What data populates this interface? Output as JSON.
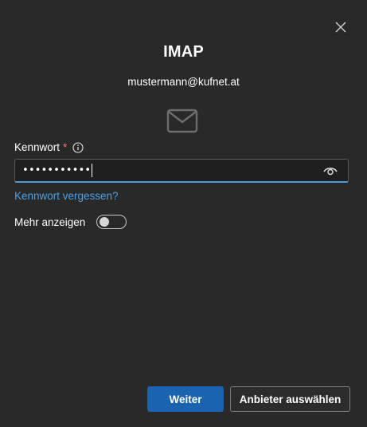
{
  "dialog": {
    "title": "IMAP",
    "email": "mustermann@kufnet.at",
    "password": {
      "label": "Kennwort",
      "required_marker": "*",
      "masked_value": "•••••••••••",
      "forgot_link": "Kennwort vergessen?"
    },
    "more": {
      "label": "Mehr anzeigen",
      "toggle_on": false
    },
    "buttons": {
      "primary": "Weiter",
      "secondary": "Anbieter auswählen"
    }
  },
  "icons": {
    "close": "close-icon",
    "mail": "mail-envelope-icon",
    "info": "info-icon",
    "show_password": "eye-icon"
  },
  "colors": {
    "background": "#292929",
    "accent": "#1a63b0",
    "link": "#4aa0e6",
    "required": "#f1707b",
    "focus_underline": "#4f9bdc"
  }
}
